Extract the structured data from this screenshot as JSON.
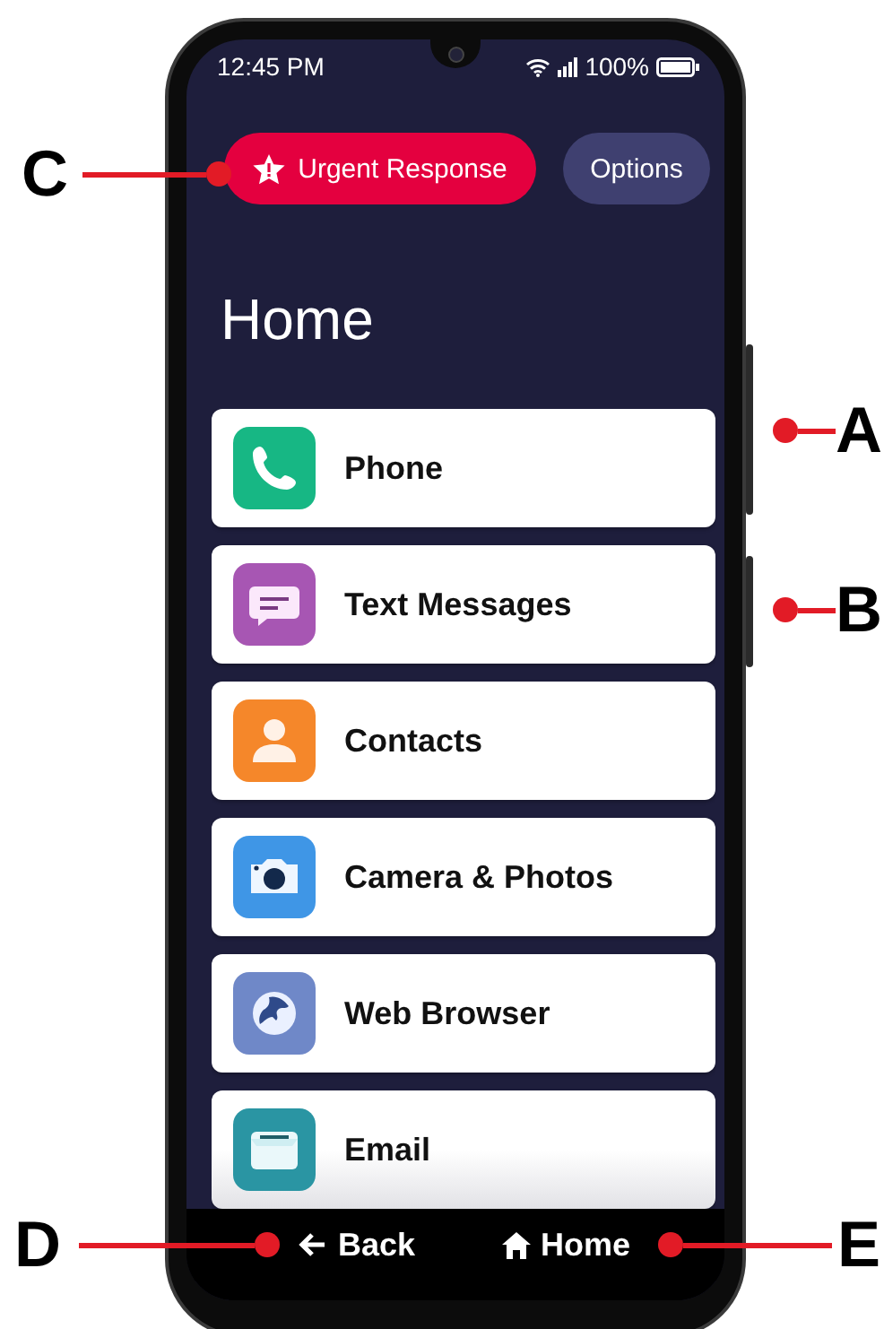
{
  "status_bar": {
    "time": "12:45 PM",
    "battery": "100%"
  },
  "header": {
    "urgent_button": "Urgent Response",
    "options_button": "Options"
  },
  "title": "Home",
  "apps": [
    {
      "label": "Phone",
      "kind": "phone"
    },
    {
      "label": "Text Messages",
      "kind": "messages"
    },
    {
      "label": "Contacts",
      "kind": "contacts"
    },
    {
      "label": "Camera & Photos",
      "kind": "camera"
    },
    {
      "label": "Web Browser",
      "kind": "browser"
    },
    {
      "label": "Email",
      "kind": "email"
    }
  ],
  "nav": {
    "back": "Back",
    "home": "Home"
  },
  "callouts": [
    {
      "label": "C",
      "kind": "left"
    },
    {
      "label": "A",
      "kind": "right"
    },
    {
      "label": "B",
      "kind": "right"
    },
    {
      "label": "D",
      "kind": "left"
    },
    {
      "label": "E",
      "kind": "right"
    }
  ]
}
